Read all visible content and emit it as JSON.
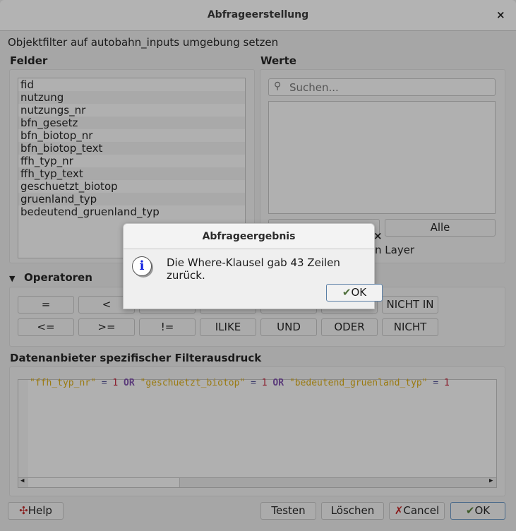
{
  "window": {
    "title": "Abfrageerstellung",
    "close": "×"
  },
  "subtitle": "Objektfilter auf autobahn_inputs umgebung setzen",
  "fields": {
    "label": "Felder",
    "items": [
      "fid",
      "nutzung",
      "nutzungs_nr",
      "bfn_gesetz",
      "bfn_biotop_nr",
      "bfn_biotop_text",
      "ffh_typ_nr",
      "ffh_typ_text",
      "geschuetzt_biotop",
      "gruenland_typ",
      "bedeutend_gruenland_typ"
    ]
  },
  "values": {
    "label": "Werte",
    "search_placeholder": "Suchen...",
    "all_button": "Alle",
    "layer_checkbox_visible": "n Layer"
  },
  "operators": {
    "label": "Operatoren",
    "row1": [
      "=",
      "<",
      "",
      "",
      "",
      "",
      "NICHT IN"
    ],
    "row2": [
      "<=",
      ">=",
      "!=",
      "ILIKE",
      "UND",
      "ODER",
      "NICHT"
    ]
  },
  "expression": {
    "label": "Datenanbieter spezifischer Filterausdruck",
    "tokens": [
      [
        "s",
        "\"ffh_typ_nr\""
      ],
      [
        "o",
        " = "
      ],
      [
        "n",
        "1"
      ],
      [
        "k",
        " OR "
      ],
      [
        "s",
        "\"geschuetzt_biotop\""
      ],
      [
        "o",
        " = "
      ],
      [
        "n",
        "1"
      ],
      [
        "k",
        " OR "
      ],
      [
        "s",
        "\"bedeutend_gruenland_typ\""
      ],
      [
        "o",
        " = "
      ],
      [
        "n",
        "1"
      ]
    ]
  },
  "buttons": {
    "help": "Help",
    "test": "Testen",
    "clear": "Löschen",
    "cancel": "Cancel",
    "ok": "OK"
  },
  "dialog": {
    "title": "Abfrageergebnis",
    "message": "Die Where-Klausel gab 43 Zeilen zurück.",
    "ok": "OK",
    "close": "×"
  }
}
